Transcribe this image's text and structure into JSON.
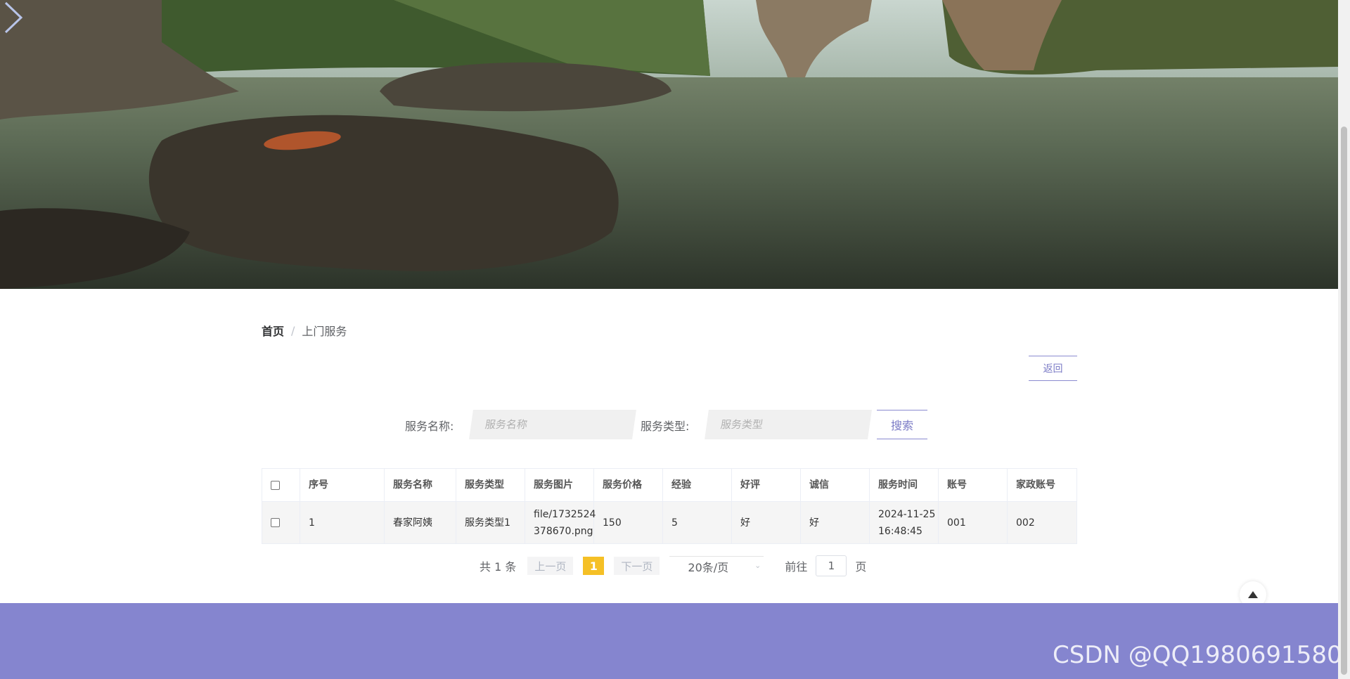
{
  "breadcrumb": {
    "home": "首页",
    "separator": "/",
    "current": "上门服务"
  },
  "back_button": "返回",
  "search": {
    "name_label": "服务名称:",
    "name_placeholder": "服务名称",
    "type_label": "服务类型:",
    "type_placeholder": "服务类型",
    "button": "搜索"
  },
  "table": {
    "columns": [
      "序号",
      "服务名称",
      "服务类型",
      "服务图片",
      "服务价格",
      "经验",
      "好评",
      "诚信",
      "服务时间",
      "账号",
      "家政账号"
    ],
    "rows": [
      {
        "index": "1",
        "name": "春家阿姨",
        "type": "服务类型1",
        "image_line1": "file/1732524",
        "image_line2": "378670.png",
        "price": "150",
        "experience": "5",
        "rating": "好",
        "integrity": "好",
        "time_date": "2024-11-25",
        "time_clock": "16:48:45",
        "account": "001",
        "housekeeping_account": "002"
      }
    ]
  },
  "pagination": {
    "total": "共 1 条",
    "prev": "上一页",
    "current_page": "1",
    "next": "下一页",
    "page_size": "20条/页",
    "goto_label": "前往",
    "goto_value": "1",
    "page_suffix": "页"
  },
  "watermark": "CSDN @QQ1980691580",
  "colors": {
    "accent": "#7b7bc6",
    "footer": "#8585cf",
    "page_active": "#f5c026"
  }
}
